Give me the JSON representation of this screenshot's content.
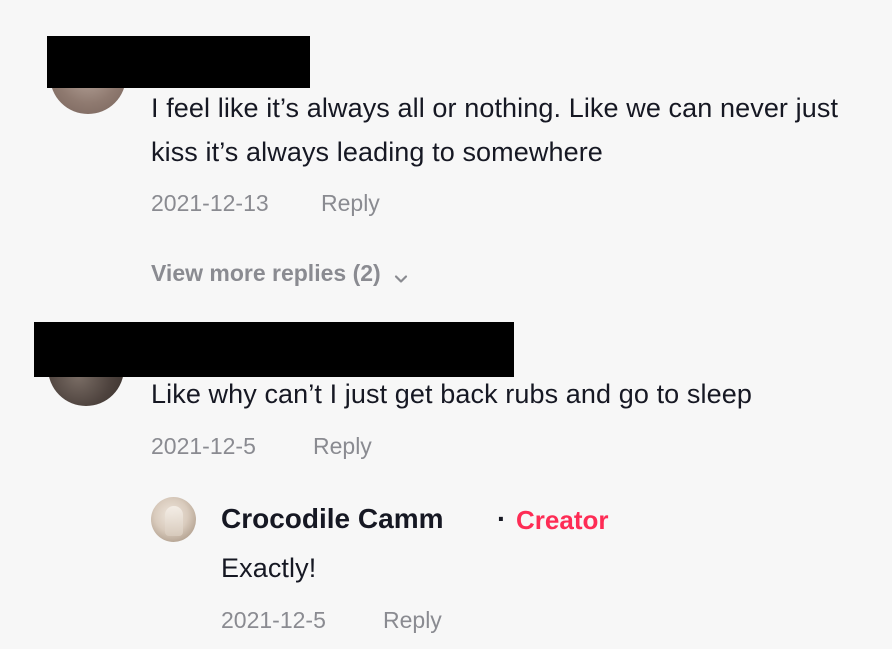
{
  "comments": [
    {
      "text": "I feel like it’s always all or nothing. Like we can never just kiss it’s always leading to somewhere",
      "date": "2021-12-13",
      "reply_label": "Reply",
      "view_more_label": "View more replies (2)"
    },
    {
      "text": "Like why can’t I just get back rubs and go to sleep",
      "date": "2021-12-5",
      "reply_label": "Reply",
      "replies": [
        {
          "username": "Crocodile Camm",
          "separator": "·",
          "badge": "Creator",
          "text": "Exactly!",
          "date": "2021-12-5",
          "reply_label": "Reply"
        }
      ]
    }
  ],
  "colors": {
    "background": "#f7f7f7",
    "text": "#161823",
    "meta": "#8a8b91",
    "creator_badge": "#fe2c55",
    "redaction": "#000000"
  },
  "icons": {
    "expand": "chevron-down-icon"
  }
}
